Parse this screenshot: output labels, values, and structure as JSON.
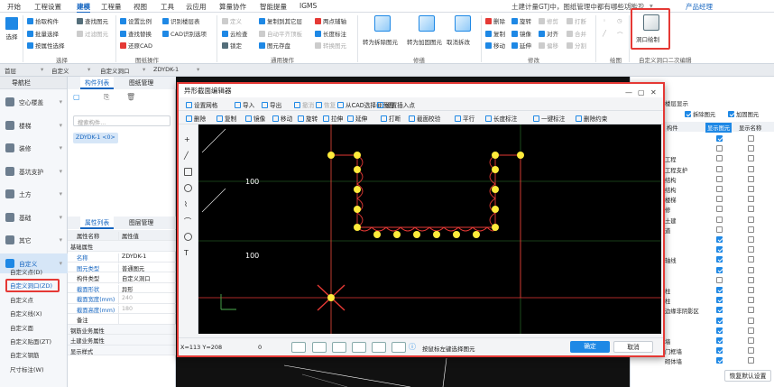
{
  "menubar": {
    "items": [
      "开始",
      "工程设置",
      "建模",
      "工程量",
      "视图",
      "工具",
      "云应用",
      "算量协作",
      "智能提量",
      "IGMS"
    ],
    "active_index": 2,
    "notice": "土建计量GTJ中，图纸管理中都有哪些功能?",
    "product_label": "产品经理"
  },
  "ribbon": {
    "select": {
      "label": "选择",
      "group": "选择"
    },
    "col1": [
      "拾取构件",
      "批量选择",
      "按属性选择"
    ],
    "col2": [
      "查找图元",
      "过滤图元"
    ],
    "col3": [
      "设置比例",
      "查找替换",
      "还原CAD"
    ],
    "col4": [
      "识别楼层表",
      "CAD识别选项"
    ],
    "col5": [
      "定义",
      "云检查",
      "锁定"
    ],
    "col6": [
      "复制到其它层",
      "自动平齐顶板",
      "图元存盘"
    ],
    "col7": [
      "两点辅轴",
      "长度标注",
      "转换图元"
    ],
    "group_drawings": "图纸操作",
    "group_general": "通用操作",
    "big_buttons": [
      "转为拆除图元",
      "转为加固图元",
      "取消拆改"
    ],
    "group_modify": "修缮",
    "edit_col1": [
      "删除",
      "复制",
      "移动"
    ],
    "edit_col2": [
      "旋转",
      "镜像",
      "延伸"
    ],
    "edit_col3": [
      "修剪",
      "对齐",
      "偏移"
    ],
    "edit_col4": [
      "打断",
      "合并",
      "分割"
    ],
    "group_edit": "修改",
    "group_draw": "绘图",
    "opening_draw": "洞口绘制",
    "group_custom": "自定义洞口二次编辑"
  },
  "filterbar": {
    "floor": "首层",
    "type": "自定义",
    "subtype": "自定义洞口",
    "component": "ZDYDK-1"
  },
  "nav": {
    "title": "导航栏",
    "items": [
      "空心楼盖",
      "楼梯",
      "装修",
      "基坑支护",
      "土方",
      "基础",
      "其它",
      "自定义"
    ],
    "selected_index": 7,
    "subitems": [
      "自定义点(D)",
      "自定义洞口(ZD)",
      "自定义点",
      "自定义线(X)",
      "自定义面",
      "自定义贴面(ZT)",
      "自定义钢筋",
      "尺寸标注(W)"
    ],
    "selected_sub_index": 1
  },
  "component_list": {
    "tabs": [
      "构件列表",
      "图纸管理"
    ],
    "search_placeholder": "搜索构件...",
    "items": [
      "ZDYDK-1 <0>"
    ]
  },
  "properties": {
    "tabs": [
      "属性列表",
      "图层管理"
    ],
    "header": [
      "属性名称",
      "属性值"
    ],
    "section_basic": "基础属性",
    "rows": [
      {
        "name": "名称",
        "value": "ZDYDK-1",
        "blue": true,
        "grey": false
      },
      {
        "name": "图元类型",
        "value": "普通图元",
        "blue": true,
        "grey": false
      },
      {
        "name": "构件类型",
        "value": "自定义洞口",
        "blue": false,
        "grey": false
      },
      {
        "name": "截面形状",
        "value": "异形",
        "blue": true,
        "grey": false
      },
      {
        "name": "截面宽度(mm)",
        "value": "240",
        "blue": true,
        "grey": true
      },
      {
        "name": "截面高度(mm)",
        "value": "180",
        "blue": true,
        "grey": true
      },
      {
        "name": "备注",
        "value": "",
        "blue": false,
        "grey": false
      }
    ],
    "sections": [
      "钢筋业务属性",
      "土建业务属性",
      "显示样式"
    ]
  },
  "right_panel": {
    "title": "楼层显示",
    "filter_demolish": "拆除图元",
    "filter_reinforce": "加固图元",
    "col_component": "构件",
    "col_show": "显示图元",
    "col_name": "显示名称",
    "rows": [
      {
        "label": "",
        "show": true,
        "name": false
      },
      {
        "label": "",
        "show": false,
        "name": false
      },
      {
        "label": "工程",
        "show": false,
        "name": false
      },
      {
        "label": "工程支护",
        "show": false,
        "name": false
      },
      {
        "label": "结构",
        "show": false,
        "name": false
      },
      {
        "label": "结构",
        "show": false,
        "name": false
      },
      {
        "label": "楼梯",
        "show": false,
        "name": false
      },
      {
        "label": "修",
        "show": false,
        "name": false
      },
      {
        "label": "土建",
        "show": false,
        "name": false
      },
      {
        "label": "道",
        "show": false,
        "name": false
      },
      {
        "label": "",
        "show": true,
        "name": false
      },
      {
        "label": "",
        "show": true,
        "name": false
      },
      {
        "label": "轴线",
        "show": true,
        "name": false
      },
      {
        "label": "",
        "show": true,
        "name": false
      },
      {
        "label": "",
        "show": false,
        "name": false
      },
      {
        "label": "柱",
        "show": true,
        "name": false
      },
      {
        "label": "柱",
        "show": true,
        "name": false
      },
      {
        "label": "边缘非阴影区",
        "show": true,
        "name": false
      },
      {
        "label": "",
        "show": true,
        "name": false
      },
      {
        "label": "",
        "show": true,
        "name": false
      },
      {
        "label": "墙",
        "show": true,
        "name": false
      },
      {
        "label": "门框墙",
        "show": true,
        "name": false
      },
      {
        "label": "砌体墙",
        "show": true,
        "name": false
      }
    ],
    "restore_button": "恢复默认设置"
  },
  "dialog": {
    "title": "异形截面编辑器",
    "toolbar1": [
      "设置网格",
      "导入",
      "导出",
      "撤消",
      "恢复",
      "从CAD选择截面图",
      "设置插入点"
    ],
    "toolbar2": [
      "删除",
      "复制",
      "镜像",
      "移动",
      "旋转",
      "拉伸",
      "延伸",
      "打断",
      "截面校验",
      "平行",
      "长度标注",
      "一键标注",
      "删除约束"
    ],
    "dim_top": "100",
    "dim_bottom": "100",
    "status_coords": "X=113 Y=208",
    "status_value": "0",
    "hint": "按鼠标左键选择图元",
    "ok": "确定",
    "cancel": "取消"
  }
}
